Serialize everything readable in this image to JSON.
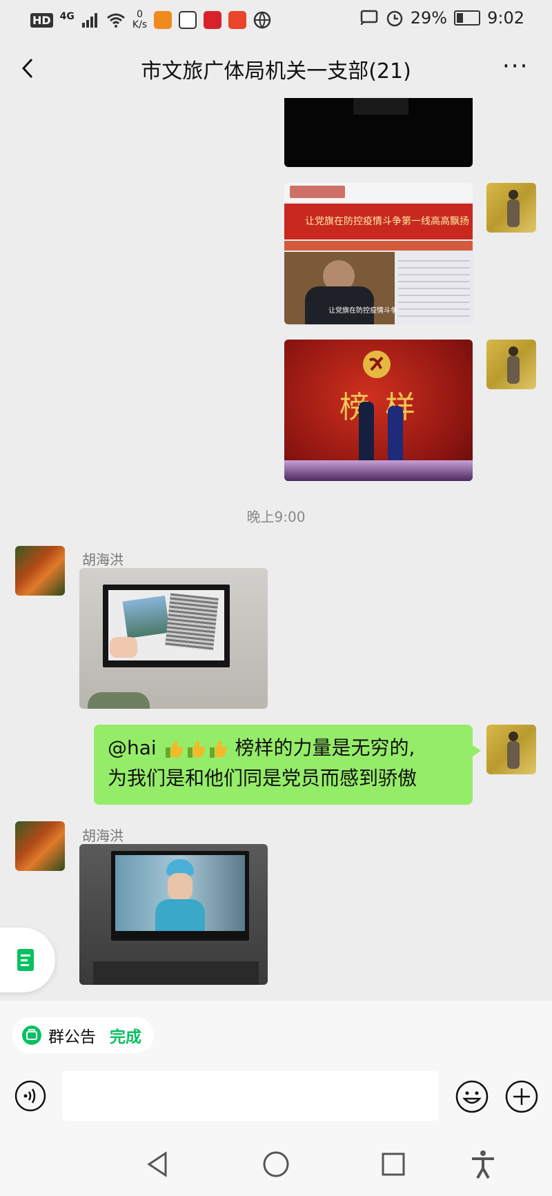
{
  "status_bar": {
    "hd": "HD",
    "network": "4G",
    "speed_value": "0",
    "speed_unit": "K/s",
    "battery": "29%",
    "time": "9:02"
  },
  "header": {
    "title": "市文旅广体局机关一支部(21)",
    "more": "···"
  },
  "chat": {
    "timestamp": "晚上9:00",
    "messages": [
      {
        "sender": "胡海洪"
      },
      {
        "text_prefix": "@hai",
        "text_line1_suffix": "榜样的力量是无穷的,",
        "text_line2": "为我们是和他们同是党员而感到骄傲"
      },
      {
        "sender": "胡海洪"
      }
    ]
  },
  "images": {
    "banner_text": "让党旗在防控疫情斗争第一线高高飘扬",
    "caption": "让党旗在防控疫情斗争第一线高高飘扬",
    "stage_text": "榜样"
  },
  "notice": {
    "label": "群公告",
    "action": "完成"
  },
  "colors": {
    "bubble": "#95ec69",
    "accent": "#07c160",
    "background": "#ededed"
  }
}
